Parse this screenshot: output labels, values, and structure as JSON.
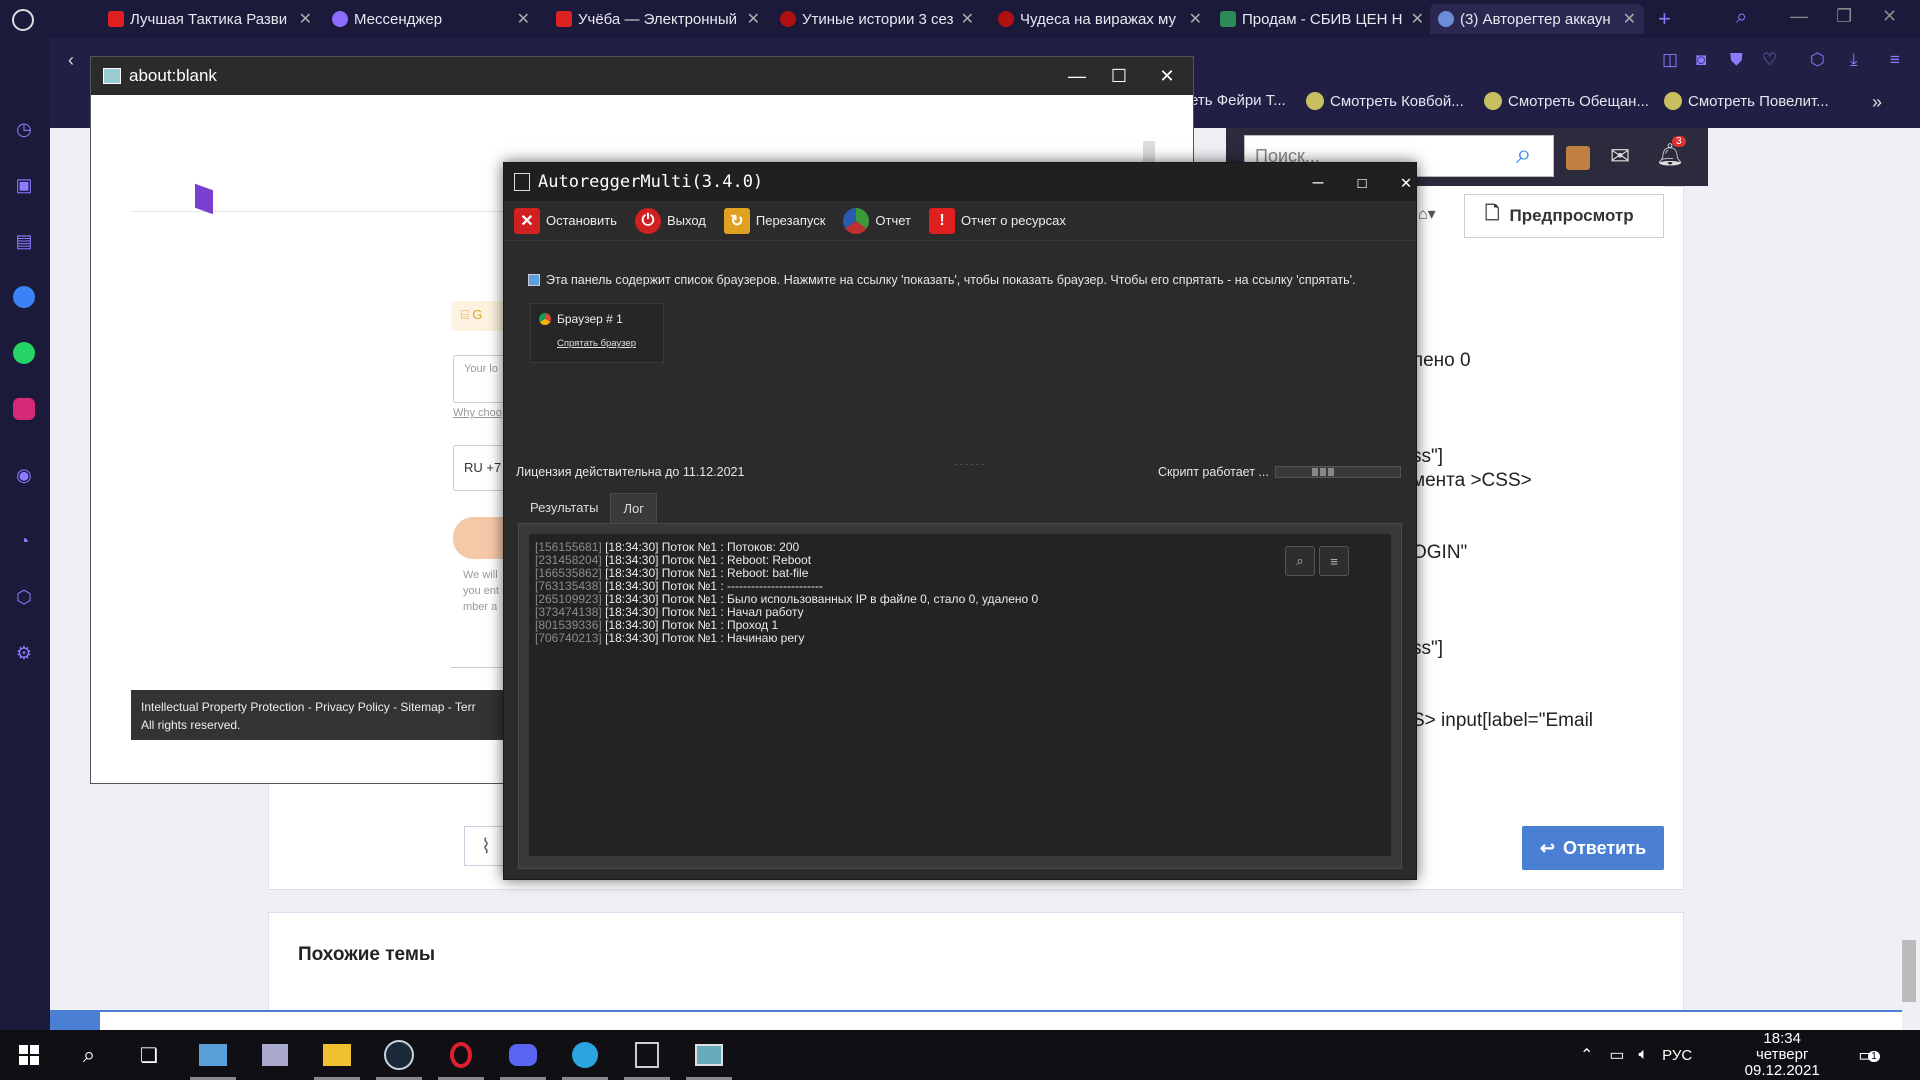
{
  "browser": {
    "tabs": [
      {
        "label": "Лучшая Тактика Разви",
        "color": "#e02020"
      },
      {
        "label": "Мессенджер",
        "color": "#8a6cff"
      },
      {
        "label": "Учёба — Электронный",
        "color": "#d22"
      },
      {
        "label": "Утиные истории 3 сез",
        "color": "#b01010"
      },
      {
        "label": "Чудеса на виражах му",
        "color": "#b01010"
      },
      {
        "label": "Продам - СБИВ ЦЕН Н",
        "color": "#2e8b57"
      },
      {
        "label": "(3) Авторегтер аккаун",
        "color": "#6c8cd5"
      }
    ],
    "bookmarks": [
      "еть Фейри Т...",
      "Смотреть Ковбой...",
      "Смотреть Обещан...",
      "Смотреть Повелит..."
    ]
  },
  "forum": {
    "search_placeholder": "Поиск...",
    "notification_count": "3",
    "preview_label": "Предпросмотр",
    "reply_label": "Ответить",
    "similar_title": "Похожие темы",
    "code_fragments": [
      "лено 0",
      "ss\"]",
      "мента >CSS>",
      "OGIN\"",
      "ss\"]",
      "S> input[label=\"Email"
    ]
  },
  "blank_window": {
    "title": "about:blank",
    "footer_line1": "Intellectual Property Protection  -  Privacy Policy  -  Sitemap  -  Terr",
    "footer_line2": "All rights reserved.",
    "frag_login": "Your lo",
    "frag_r": "R",
    "frag_why": "Why choo",
    "frag_phone": "RU +7",
    "frag_notice1": "We will",
    "frag_notice2": "you ent",
    "frag_notice3": "mber a"
  },
  "autoregger": {
    "title": "AutoreggerMulti(3.4.0)",
    "toolbar": {
      "stop": "Остановить",
      "exit": "Выход",
      "restart": "Перезапуск",
      "report": "Отчет",
      "resources": "Отчет о ресурсах"
    },
    "info": "Эта панель содержит список браузеров. Нажмите на ссылку 'показать', чтобы показать браузер. Чтобы его спрятать - на ссылку 'спрятать'.",
    "browser_card": {
      "name": "Браузер # 1",
      "hide_link": "Спрятать браузер"
    },
    "license": "Лицензия действительна до 11.12.2021",
    "script_status": "Скрипт работает ...",
    "tabs": [
      "Результаты",
      "Лог"
    ],
    "log": [
      {
        "id": "[156155681]",
        "text": "[18:34:30] Поток №1 : Потоков: 200"
      },
      {
        "id": "[231458204]",
        "text": "[18:34:30] Поток №1 : Reboot: Reboot"
      },
      {
        "id": "[166535862]",
        "text": "[18:34:30] Поток №1 : Reboot: bat-file"
      },
      {
        "id": "[763135438]",
        "text": "[18:34:30] Поток №1 : ------------------------"
      },
      {
        "id": "[265109923]",
        "text": "[18:34:30] Поток №1 : Было использованных IP в файле 0, стало 0, удалено 0"
      },
      {
        "id": "[373474138]",
        "text": "[18:34:30] Поток №1 : Начал работу"
      },
      {
        "id": "[801539336]",
        "text": "[18:34:30] Поток №1 : Проход 1"
      },
      {
        "id": "[706740213]",
        "text": "[18:34:30] Поток №1 : Начинаю регу"
      }
    ]
  },
  "taskbar": {
    "lang": "РУС",
    "time": "18:34",
    "day": "четверг",
    "date": "09.12.2021",
    "notif_count": "1"
  }
}
